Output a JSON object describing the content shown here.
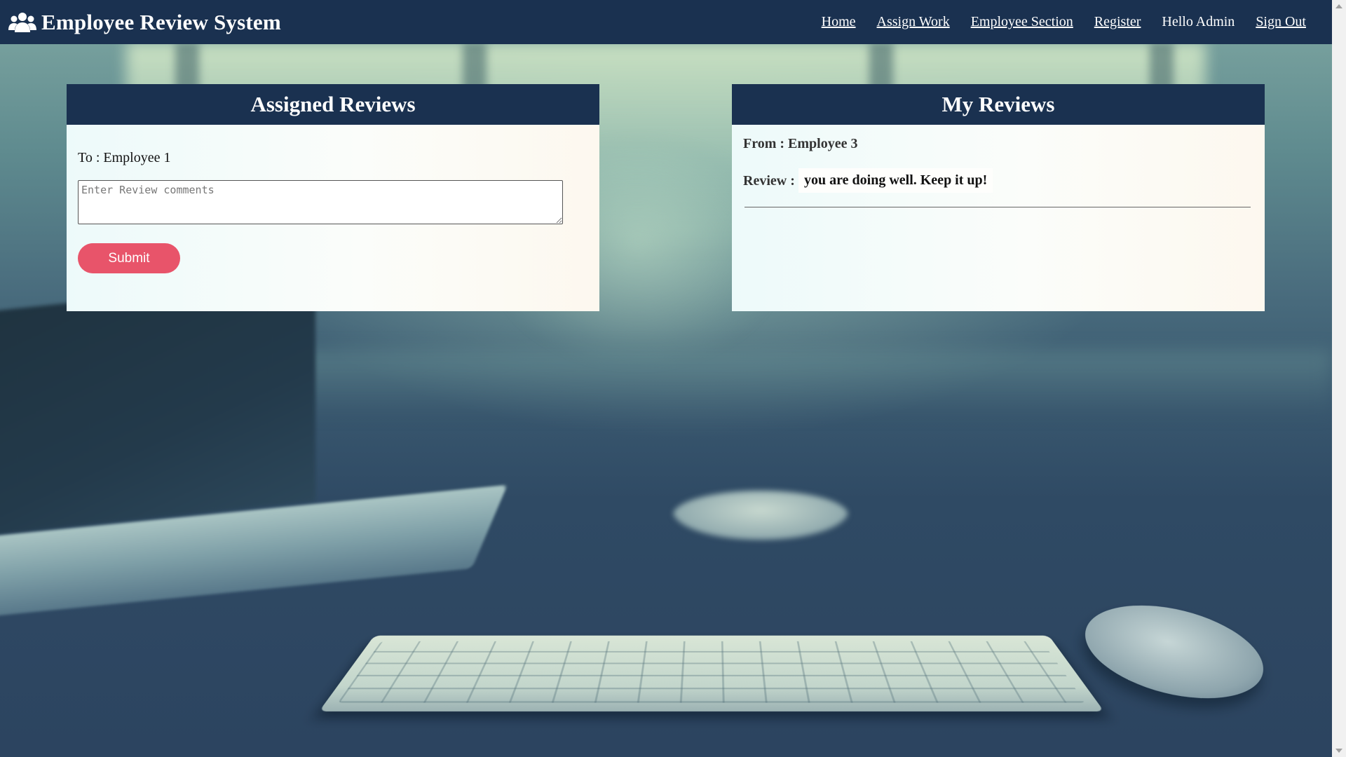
{
  "app": {
    "title": "Employee Review System",
    "brand_icon": "users-icon"
  },
  "nav": {
    "home": "Home",
    "assign_work": "Assign Work",
    "employee_section": "Employee Section",
    "register": "Register",
    "greeting": "Hello Admin",
    "sign_out": "Sign Out"
  },
  "assigned": {
    "title": "Assigned Reviews",
    "to_label": "To : Employee 1",
    "placeholder": "Enter Review comments",
    "submit_label": "Submit"
  },
  "my_reviews": {
    "title": "My Reviews",
    "items": [
      {
        "from": "From : Employee 3",
        "review_label": "Review :",
        "text": "you are doing well. Keep it up!"
      }
    ]
  },
  "colors": {
    "navbar": "#1a3150",
    "submit_button": "#e8546a",
    "panel_bg": "#f7fcf9"
  }
}
